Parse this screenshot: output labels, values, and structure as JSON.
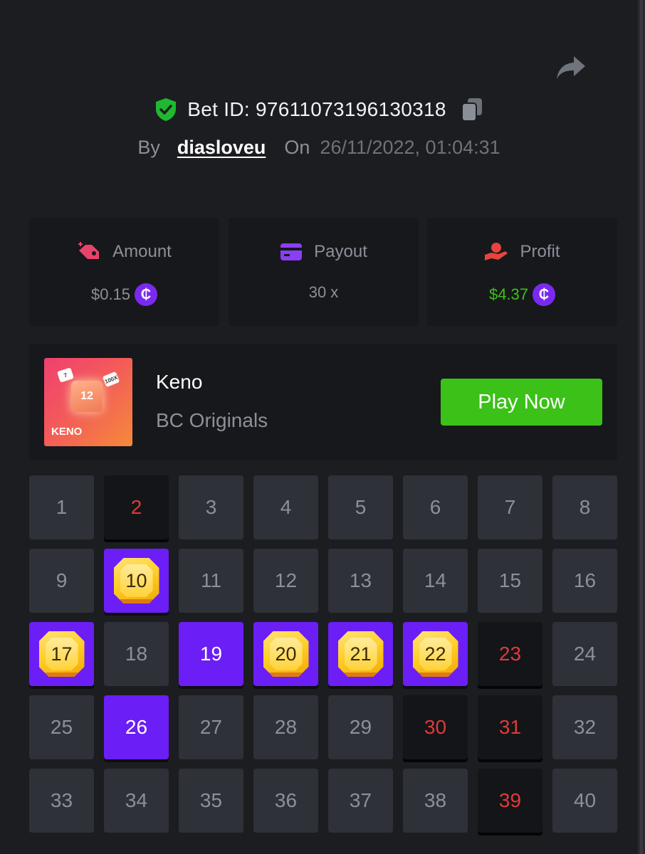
{
  "header": {
    "bet_id": "Bet ID: 97611073196130318",
    "by_label": "By",
    "username": "diasloveu",
    "on_label": "On",
    "datetime": "26/11/2022, 01:04:31"
  },
  "stats": {
    "amount": {
      "label": "Amount",
      "value": "$0.15"
    },
    "payout": {
      "label": "Payout",
      "value": "30 x"
    },
    "profit": {
      "label": "Profit",
      "value": "$4.37"
    },
    "coin_symbol": "₵"
  },
  "game": {
    "thumb_label": "KENO",
    "thumb_gem_number": "12",
    "thumb_die_1": "7",
    "thumb_die_2": "100X",
    "name": "Keno",
    "provider": "BC Originals",
    "play_button": "Play Now"
  },
  "colors": {
    "accent_purple": "#6b1ef5",
    "profit_green": "#3bc117",
    "miss_red": "#e03a3a",
    "shield_green": "#1fb82f"
  },
  "board": {
    "tiles": [
      {
        "n": "1",
        "state": "normal"
      },
      {
        "n": "2",
        "state": "miss"
      },
      {
        "n": "3",
        "state": "normal"
      },
      {
        "n": "4",
        "state": "normal"
      },
      {
        "n": "5",
        "state": "normal"
      },
      {
        "n": "6",
        "state": "normal"
      },
      {
        "n": "7",
        "state": "normal"
      },
      {
        "n": "8",
        "state": "normal"
      },
      {
        "n": "9",
        "state": "normal"
      },
      {
        "n": "10",
        "state": "hit"
      },
      {
        "n": "11",
        "state": "normal"
      },
      {
        "n": "12",
        "state": "normal"
      },
      {
        "n": "13",
        "state": "normal"
      },
      {
        "n": "14",
        "state": "normal"
      },
      {
        "n": "15",
        "state": "normal"
      },
      {
        "n": "16",
        "state": "normal"
      },
      {
        "n": "17",
        "state": "hit"
      },
      {
        "n": "18",
        "state": "normal"
      },
      {
        "n": "19",
        "state": "pick"
      },
      {
        "n": "20",
        "state": "hit"
      },
      {
        "n": "21",
        "state": "hit"
      },
      {
        "n": "22",
        "state": "hit"
      },
      {
        "n": "23",
        "state": "miss"
      },
      {
        "n": "24",
        "state": "normal"
      },
      {
        "n": "25",
        "state": "normal"
      },
      {
        "n": "26",
        "state": "pick"
      },
      {
        "n": "27",
        "state": "normal"
      },
      {
        "n": "28",
        "state": "normal"
      },
      {
        "n": "29",
        "state": "normal"
      },
      {
        "n": "30",
        "state": "miss"
      },
      {
        "n": "31",
        "state": "miss"
      },
      {
        "n": "32",
        "state": "normal"
      },
      {
        "n": "33",
        "state": "normal"
      },
      {
        "n": "34",
        "state": "normal"
      },
      {
        "n": "35",
        "state": "normal"
      },
      {
        "n": "36",
        "state": "normal"
      },
      {
        "n": "37",
        "state": "normal"
      },
      {
        "n": "38",
        "state": "normal"
      },
      {
        "n": "39",
        "state": "miss"
      },
      {
        "n": "40",
        "state": "normal"
      }
    ]
  }
}
